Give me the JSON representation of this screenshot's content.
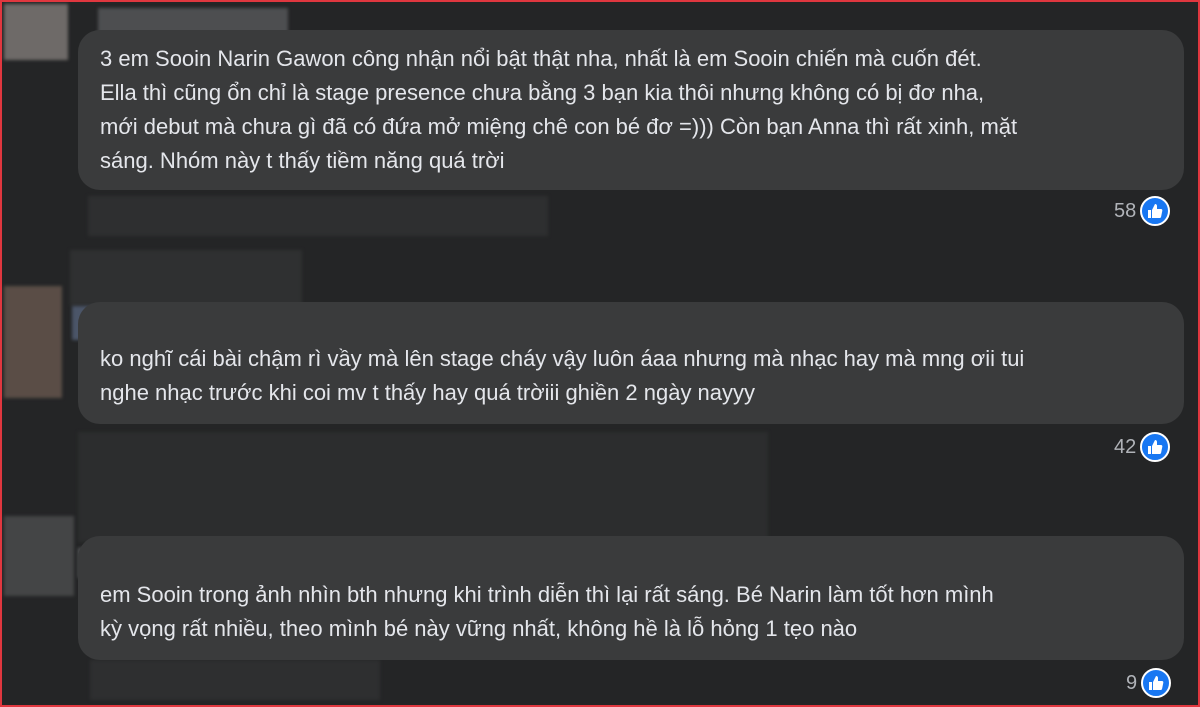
{
  "comments": [
    {
      "lines": [
        "3 em Sooin Narin Gawon công nhận nổi bật thật nha, nhất là em Sooin chiến mà cuốn đét.",
        "Ella thì cũng ổn chỉ là stage presence chưa bằng 3 bạn kia thôi nhưng không có bị đơ nha,",
        "mới debut mà chưa gì đã có đứa mở miệng chê con bé đơ =))) Còn bạn Anna thì rất xinh, mặt",
        "sáng. Nhóm này t thấy tiềm năng quá trời"
      ],
      "likes": "58"
    },
    {
      "lines": [
        "ko nghĩ cái bài chậm rì vầy mà lên stage cháy vậy luôn áaa nhưng mà nhạc hay mà mng ơii tui",
        "nghe nhạc trước khi coi mv t thấy hay quá trờiii ghiền 2 ngày nayyy"
      ],
      "likes": "42"
    },
    {
      "lines": [
        "em Sooin trong ảnh nhìn bth nhưng khi trình diễn thì lại rất sáng. Bé Narin làm tốt hơn mình",
        "kỳ vọng rất nhiều, theo mình bé này vững nhất, không hề là lỗ hỏng 1 tẹo nào"
      ],
      "likes": "9"
    }
  ],
  "colors": {
    "background": "#242526",
    "bubble": "#3a3b3c",
    "text": "#e4e6eb",
    "like_blue": "#1877f2",
    "frame_red": "#e0373f"
  },
  "icons": [
    "like-icon"
  ]
}
